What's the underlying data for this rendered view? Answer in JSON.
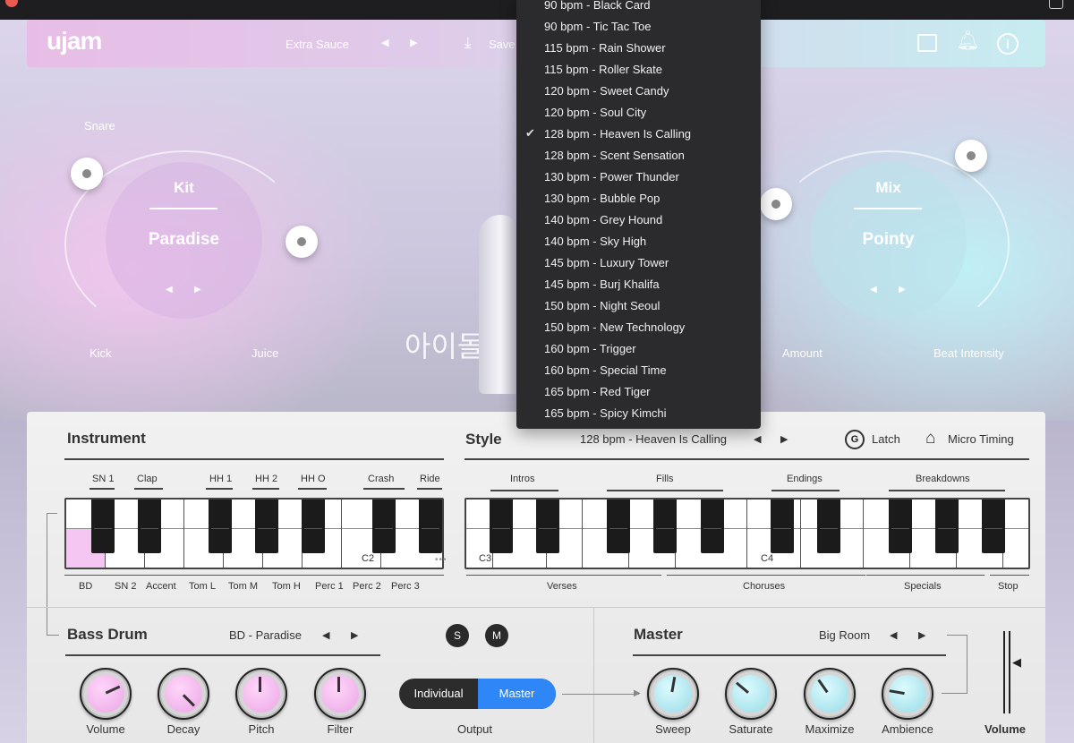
{
  "header": {
    "logo": "ujam",
    "preset": "Extra Sauce",
    "save": "Save"
  },
  "kit": {
    "title": "Kit",
    "value": "Paradise",
    "labels": {
      "snare": "Snare",
      "kick": "Kick",
      "juice": "Juice"
    }
  },
  "mix": {
    "title": "Mix",
    "value": "Pointy",
    "labels": {
      "amount": "Amount",
      "beat": "Beat Intensity"
    }
  },
  "center_text": "아이돌",
  "style_dropdown": {
    "selected": "128 bpm - Heaven Is Calling",
    "items": [
      "90 bpm - Black Card",
      "90 bpm - Tic Tac Toe",
      "115 bpm - Rain Shower",
      "115 bpm - Roller Skate",
      "120 bpm - Sweet Candy",
      "120 bpm - Soul City",
      "128 bpm - Heaven Is Calling",
      "128 bpm - Scent Sensation",
      "130 bpm - Power Thunder",
      "130 bpm - Bubble Pop",
      "140 bpm - Grey Hound",
      "140 bpm - Sky High",
      "145 bpm - Luxury Tower",
      "145 bpm - Burj Khalifa",
      "150 bpm - Night Seoul",
      "150 bpm - New Technology",
      "160 bpm - Trigger",
      "160 bpm - Special Time",
      "165 bpm - Red Tiger",
      "165 bpm - Spicy Kimchi"
    ]
  },
  "instrument": {
    "title": "Instrument",
    "top_labels": [
      "SN 1",
      "Clap",
      "HH 1",
      "HH 2",
      "HH O",
      "Crash",
      "Ride"
    ],
    "bottom_labels": [
      "BD",
      "SN 2",
      "Accent",
      "Tom L",
      "Tom M",
      "Tom H",
      "Perc 1",
      "Perc 2",
      "Perc 3"
    ],
    "note": "C2"
  },
  "style": {
    "title": "Style",
    "value": "128 bpm - Heaven Is Calling",
    "latch": "Latch",
    "micro": "Micro Timing",
    "top_labels": [
      "Intros",
      "Fills",
      "Endings",
      "Breakdowns"
    ],
    "bottom_labels": [
      "Verses",
      "Choruses",
      "Specials",
      "Stop"
    ],
    "notes": [
      "C3",
      "C4"
    ]
  },
  "bass": {
    "title": "Bass Drum",
    "preset": "BD - Paradise",
    "solo": "S",
    "mute": "M",
    "knobs": [
      "Volume",
      "Decay",
      "Pitch",
      "Filter"
    ]
  },
  "output": {
    "label": "Output",
    "individual": "Individual",
    "master": "Master"
  },
  "master": {
    "title": "Master",
    "preset": "Big Room",
    "knobs": [
      "Sweep",
      "Saturate",
      "Maximize",
      "Ambience"
    ],
    "volume": "Volume"
  }
}
